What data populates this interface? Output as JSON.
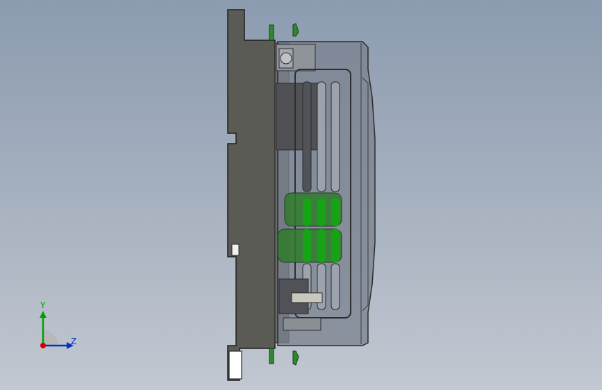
{
  "viewport": {
    "background_top": "#8c9bb0",
    "background_bottom": "#c2c8d1"
  },
  "model": {
    "mount_color": "#5b5b55",
    "housing_color": "#777f8c",
    "slot_color": "#505050",
    "capacitor_color": "#2f7a2b",
    "clip_color": "#2c8a2c"
  },
  "triad": {
    "y_label": "Y",
    "z_label": "Z",
    "x_color": "#d40000",
    "y_color": "#00a000",
    "z_color": "#0033cc"
  }
}
